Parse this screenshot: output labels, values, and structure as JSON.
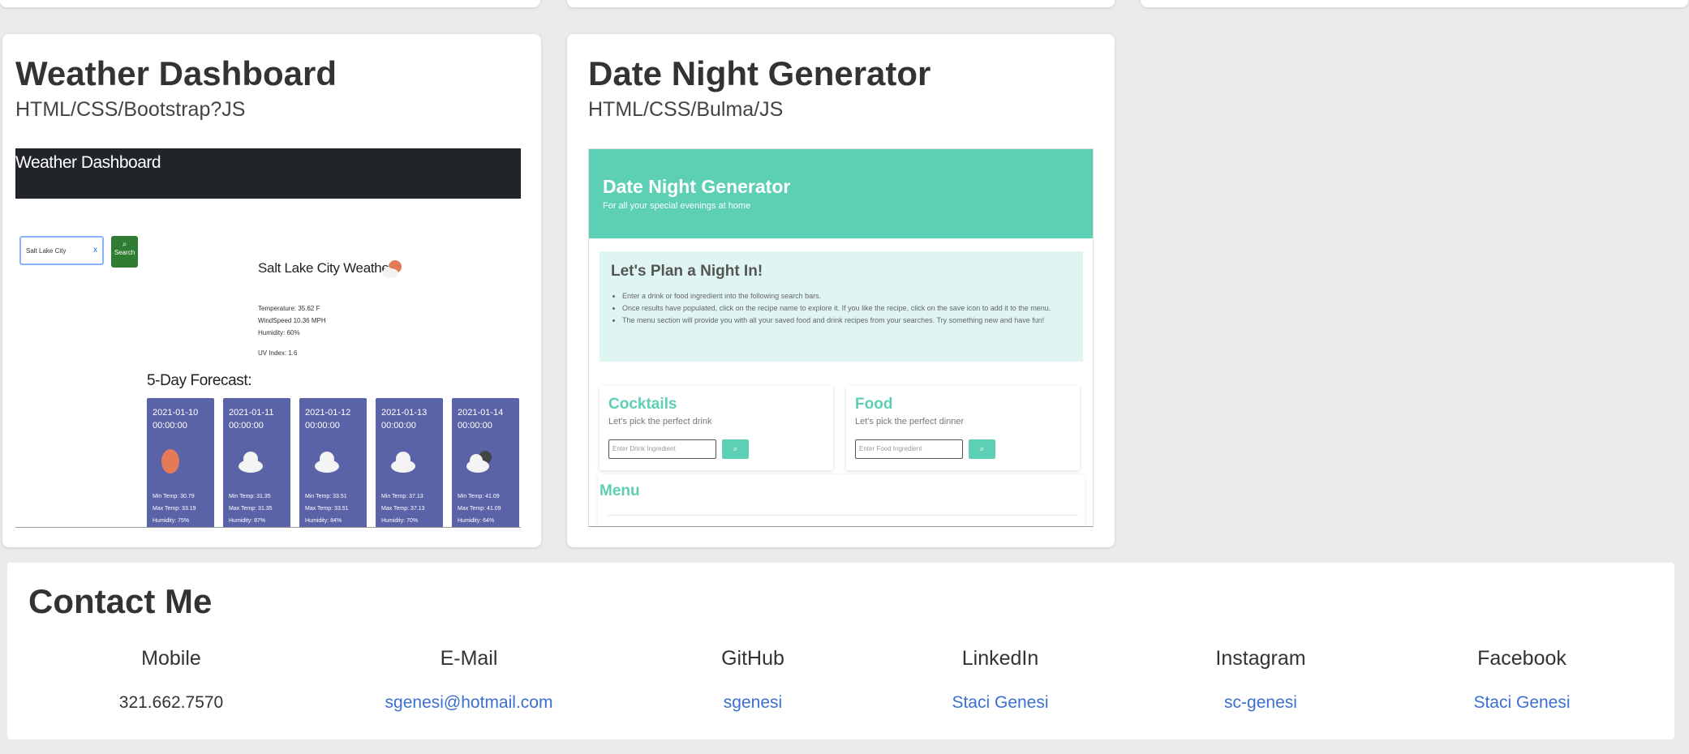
{
  "projects": [
    {
      "title": "Weather Dashboard",
      "tech": "HTML/CSS/Bootstrap?JS"
    },
    {
      "title": "Date Night Generator",
      "tech": "HTML/CSS/Bulma/JS"
    }
  ],
  "weather_shot": {
    "header": "Weather Dashboard",
    "search_value": "Salt Lake City",
    "clear": "x",
    "search_button": "Search",
    "city_title": "Salt Lake City Weather",
    "details": [
      "Temperature: 35.62 F",
      "WindSpeed 10.36 MPH",
      "Humidity: 60%"
    ],
    "uv": "UV Index: 1.6",
    "forecast_title": "5-Day Forecast:",
    "days": [
      {
        "date": "2021-01-10",
        "time": "00:00:00",
        "icon": "sun-icon",
        "min": "Min Temp: 30.79",
        "max": "Max Temp: 33.19",
        "humidity": "Humidity: 75%"
      },
      {
        "date": "2021-01-11",
        "time": "00:00:00",
        "icon": "cloud-icon",
        "min": "Min Temp: 31.35",
        "max": "Max Temp: 31.35",
        "humidity": "Humidity: 87%"
      },
      {
        "date": "2021-01-12",
        "time": "00:00:00",
        "icon": "cloud-icon",
        "min": "Min Temp: 33.51",
        "max": "Max Temp: 33.51",
        "humidity": "Humidity: 84%"
      },
      {
        "date": "2021-01-13",
        "time": "00:00:00",
        "icon": "cloud-icon",
        "min": "Min Temp: 37.13",
        "max": "Max Temp: 37.13",
        "humidity": "Humidity: 70%"
      },
      {
        "date": "2021-01-14",
        "time": "00:00:00",
        "icon": "dark-cloud-icon",
        "min": "Min Temp: 41.09",
        "max": "Max Temp: 41.09",
        "humidity": "Humidity: 64%"
      }
    ]
  },
  "datenight_shot": {
    "title": "Date Night Generator",
    "subtitle": "For all your special evenings at home",
    "info_title": "Let's Plan a Night In!",
    "info_items": [
      "Enter a drink or food ingredient into the following search bars.",
      "Once results have populated, click on the recipe name to explore it. If you like the recipe, click on the save icon to add it to the menu.",
      "The menu section will provide you with all your saved food and drink recipes from your searches. Try something new and have fun!"
    ],
    "cocktails": {
      "title": "Cocktails",
      "subtitle": "Let's pick the perfect drink",
      "placeholder": "Enter Drink Ingredient"
    },
    "food": {
      "title": "Food",
      "subtitle": "Let's pick the perfect dinner",
      "placeholder": "Enter Food Ingredient"
    },
    "menu_title": "Menu"
  },
  "contact": {
    "title": "Contact Me",
    "items": [
      {
        "label": "Mobile",
        "value": "321.662.7570"
      },
      {
        "label": "E-Mail",
        "value": "sgenesi@hotmail.com"
      },
      {
        "label": "GitHub",
        "value": "sgenesi"
      },
      {
        "label": "LinkedIn",
        "value": "Staci Genesi"
      },
      {
        "label": "Instagram",
        "value": "sc-genesi"
      },
      {
        "label": "Facebook",
        "value": "Staci Genesi"
      }
    ]
  },
  "colors": {
    "accent_teal": "#5dcfb4",
    "link_blue": "#3b6fd1",
    "forecast_card": "#5b63a8"
  }
}
